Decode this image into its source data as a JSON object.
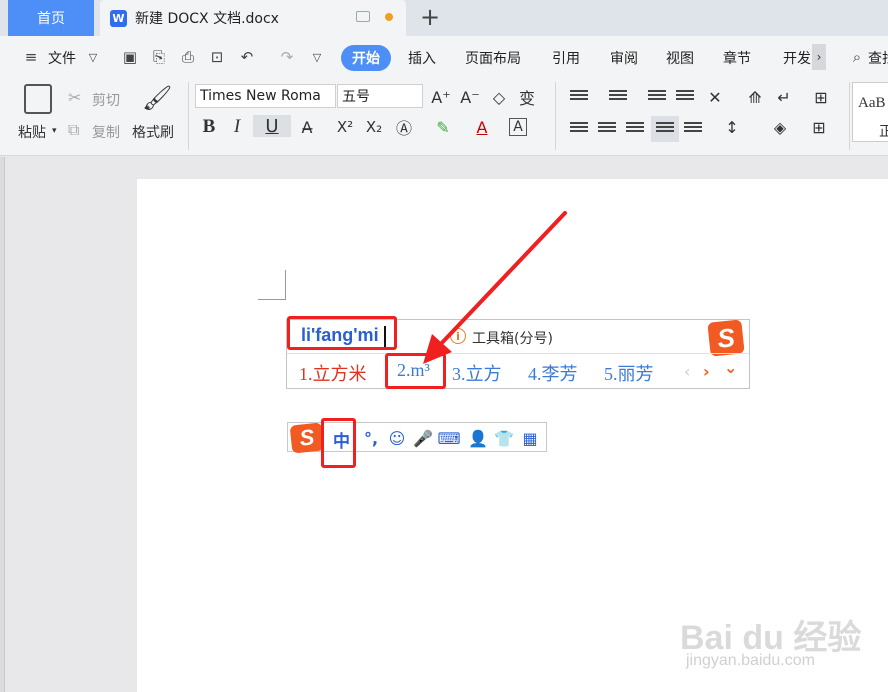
{
  "titlebar": {
    "home_tab": "首页",
    "doc_tab_logo": "W",
    "doc_tab_title": "新建 DOCX 文档.docx",
    "plus": "+"
  },
  "menubar": {
    "file": "文件",
    "tabs": [
      "开始",
      "插入",
      "页面布局",
      "引用",
      "审阅",
      "视图",
      "章节",
      "开发"
    ],
    "search": "查找",
    "more": "›"
  },
  "ribbon": {
    "paste": "粘贴",
    "cut": "剪切",
    "copy": "复制",
    "format_painter": "格式刷",
    "font_name": "Times New Roma",
    "font_size": "五号",
    "bold": "B",
    "italic": "I",
    "underline": "U",
    "superscript": "X²",
    "subscript": "X₂",
    "style_preview": "AaB",
    "style_label": "正"
  },
  "ime": {
    "pinyin": "li'fang'mi",
    "toolbox_label": "工具箱(分号)",
    "logo_letter": "S",
    "candidates": [
      "1.立方米",
      "2.m³",
      "3.立方",
      "4.李芳",
      "5.丽芳"
    ],
    "prev": "‹",
    "next": "›",
    "expand": "⌄"
  },
  "imebar": {
    "mode": "中",
    "punct": "°,",
    "emoji": "☺",
    "voice": "🎤",
    "keyboard": "⌨",
    "skin": "👕",
    "tools": "▦"
  },
  "watermark": {
    "brand": "Bai du 经验",
    "url": "jingyan.baidu.com"
  },
  "colors": {
    "accent": "#4d8ff6",
    "ime_blue": "#2a5fcf",
    "candidate_red": "#e0321f",
    "highlight_red": "#f02020",
    "sogou_orange": "#f15a22"
  }
}
